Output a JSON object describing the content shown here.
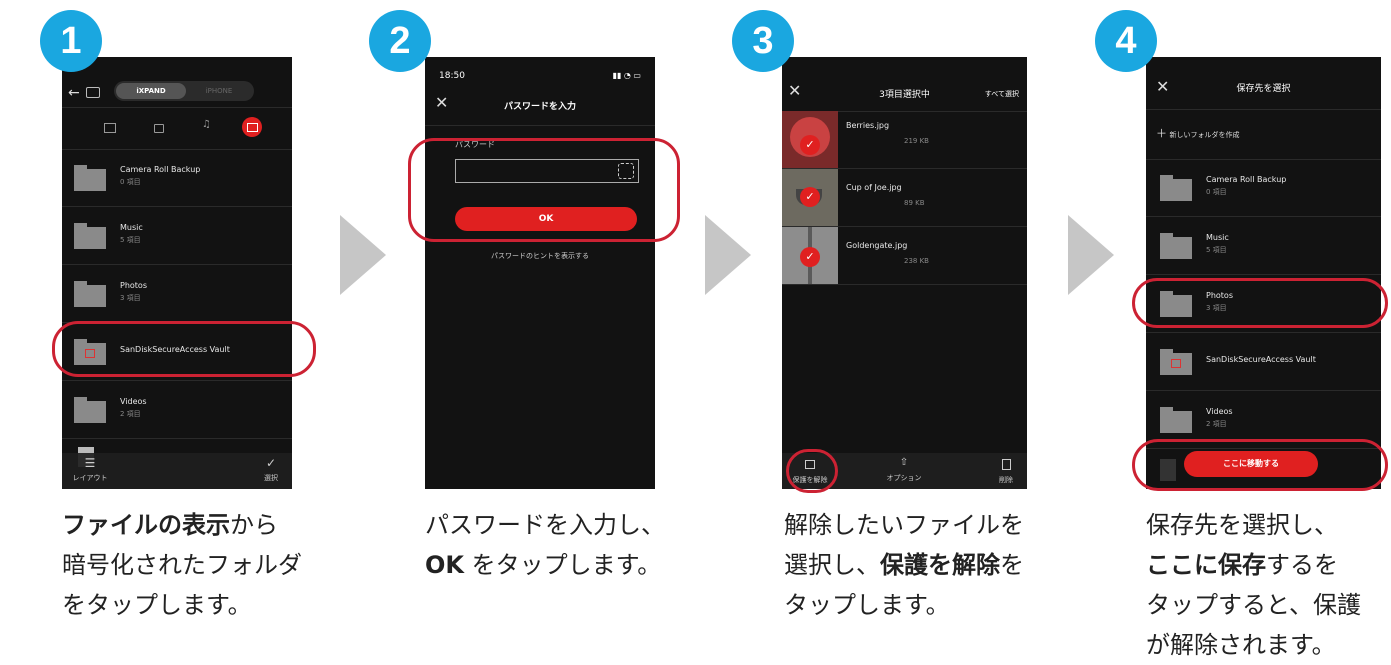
{
  "steps": [
    {
      "number": "1"
    },
    {
      "number": "2"
    },
    {
      "number": "3"
    },
    {
      "number": "4"
    }
  ],
  "screen1": {
    "tab_ixpand": "iXPAND",
    "tab_iphone": "iPHONE",
    "folders": [
      {
        "name": "Camera Roll Backup",
        "sub": "0 項目"
      },
      {
        "name": "Music",
        "sub": "5 項目"
      },
      {
        "name": "Photos",
        "sub": "3 項目"
      },
      {
        "name": "SanDiskSecureAccess Vault",
        "sub": ""
      },
      {
        "name": "Videos",
        "sub": "2 項目"
      }
    ],
    "bottom_layout": "レイアウト",
    "bottom_select": "選択"
  },
  "screen2": {
    "time": "18:50",
    "title": "パスワードを入力",
    "field_label": "パスワード",
    "ok": "OK",
    "hint": "パスワードのヒントを表示する"
  },
  "screen3": {
    "title": "3項目選択中",
    "select_all": "すべて選択",
    "files": [
      {
        "name": "Berries.jpg",
        "size": "219 KB"
      },
      {
        "name": "Cup of Joe.jpg",
        "size": "89 KB"
      },
      {
        "name": "Goldengate.jpg",
        "size": "238 KB"
      }
    ],
    "unprotect": "保護を解除",
    "options": "オプション",
    "delete": "削除"
  },
  "screen4": {
    "title": "保存先を選択",
    "new_folder": "新しいフォルダを作成",
    "folders": [
      {
        "name": "Camera Roll Backup",
        "sub": "0 項目"
      },
      {
        "name": "Music",
        "sub": "5 項目"
      },
      {
        "name": "Photos",
        "sub": "3 項目"
      },
      {
        "name": "SanDiskSecureAccess Vault",
        "sub": ""
      },
      {
        "name": "Videos",
        "sub": "2 項目"
      }
    ],
    "move_here": "ここに移動する"
  },
  "captions": {
    "c1_bold": "ファイルの表示",
    "c1_rest1": "から",
    "c1_line2": "暗号化されたフォルダ",
    "c1_line3": "をタップします。",
    "c2_line1": "パスワードを入力し、",
    "c2_bold": "OK",
    "c2_rest": " をタップします。",
    "c3_line1": "解除したいファイルを",
    "c3_pre": "選択し、",
    "c3_bold": "保護を解除",
    "c3_post": "を",
    "c3_line3": "タップします。",
    "c4_line1": "保存先を選択し、",
    "c4_bold": "ここに保存",
    "c4_rest": "するを",
    "c4_line3": "タップすると、保護",
    "c4_line4": "が解除されます。"
  },
  "colors": {
    "badge": "#1aa7e0",
    "accent_red": "#e02020",
    "ring": "#cc2233"
  }
}
